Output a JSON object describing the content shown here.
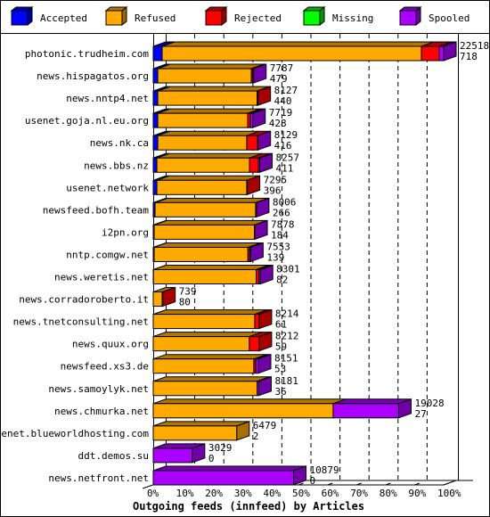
{
  "chart_data": {
    "type": "bar",
    "orientation": "horizontal",
    "stacked": true,
    "style": "3d",
    "title": "Outgoing feeds (innfeed) by Articles",
    "xlim": [
      0,
      100
    ],
    "x_unit": "%",
    "x_ticks": [
      "0%",
      "10%",
      "20%",
      "30%",
      "40%",
      "50%",
      "60%",
      "70%",
      "80%",
      "90%",
      "100%"
    ],
    "grid": true,
    "legend_placement": "top",
    "legend": [
      {
        "name": "Accepted",
        "color": "#0000ff"
      },
      {
        "name": "Refused",
        "color": "#ffaa00"
      },
      {
        "name": "Rejected",
        "color": "#ff0000"
      },
      {
        "name": "Missing",
        "color": "#00ff00"
      },
      {
        "name": "Spooled",
        "color": "#aa00ff"
      }
    ],
    "categories": [
      "photonic.trudheim.com",
      "news.hispagatos.org",
      "news.nntp4.net",
      "usenet.goja.nl.eu.org",
      "news.nk.ca",
      "news.bbs.nz",
      "usenet.network",
      "newsfeed.bofh.team",
      "i2pn.org",
      "nntp.comgw.net",
      "news.weretis.net",
      "news.corradoroberto.it",
      "news.tnetconsulting.net",
      "news.quux.org",
      "newsfeed.xs3.de",
      "news.samoylyk.net",
      "news.chmurka.net",
      "usenet.blueworldhosting.com",
      "ddt.demos.su",
      "news.netfront.net"
    ],
    "totals": [
      "22518",
      "7787",
      "8127",
      "7719",
      "8129",
      "8257",
      "7295",
      "8006",
      "7878",
      "7553",
      "8301",
      "739",
      "8214",
      "8212",
      "8151",
      "8181",
      "19028",
      "6479",
      "3029",
      "10879"
    ],
    "second_values": [
      "718",
      "479",
      "440",
      "428",
      "416",
      "411",
      "396",
      "266",
      "184",
      "139",
      "82",
      "80",
      "61",
      "59",
      "53",
      "36",
      "27",
      "2",
      "0",
      "0"
    ],
    "series": [
      {
        "name": "Accepted",
        "values": [
          690,
          350,
          350,
          350,
          350,
          280,
          280,
          140,
          70,
          70,
          20,
          0,
          0,
          0,
          0,
          0,
          0,
          0,
          0,
          0
        ]
      },
      {
        "name": "Refused",
        "values": [
          20100,
          7250,
          7700,
          6975,
          6900,
          7180,
          6970,
          7800,
          7780,
          7270,
          7960,
          690,
          7870,
          7450,
          7800,
          8050,
          13950,
          6479,
          0,
          0
        ]
      },
      {
        "name": "Rejected",
        "values": [
          1380,
          120,
          77,
          200,
          850,
          690,
          45,
          0,
          0,
          140,
          200,
          49,
          344,
          762,
          150,
          0,
          0,
          0,
          0,
          0
        ]
      },
      {
        "name": "Missing",
        "values": [
          0,
          0,
          0,
          0,
          0,
          0,
          0,
          0,
          0,
          0,
          0,
          0,
          0,
          0,
          0,
          0,
          0,
          0,
          0,
          0
        ]
      },
      {
        "name": "Spooled",
        "values": [
          348,
          67,
          0,
          194,
          29,
          107,
          0,
          66,
          28,
          73,
          121,
          0,
          0,
          0,
          201,
          131,
          5078,
          0,
          3029,
          10879
        ]
      }
    ]
  }
}
